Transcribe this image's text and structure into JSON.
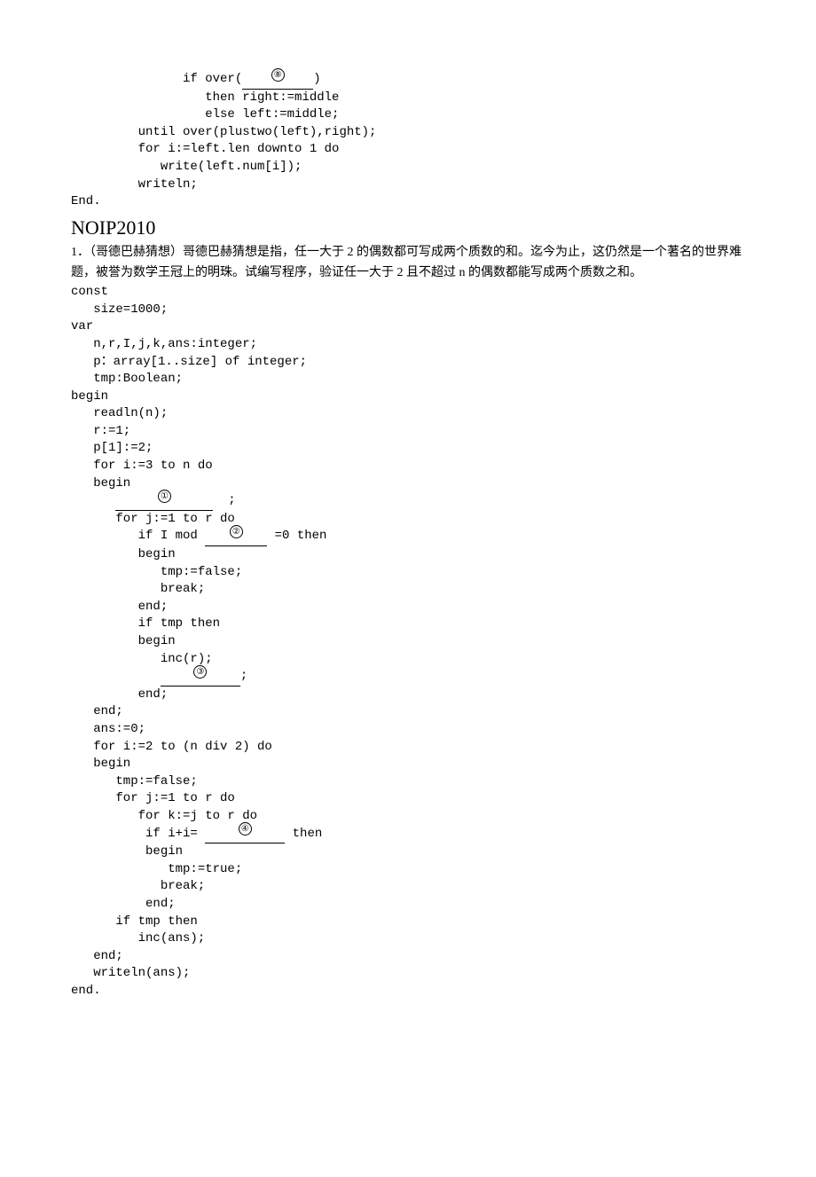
{
  "top_code": {
    "l1_pre": "               if over(",
    "l1_blank": "⑧",
    "l1_post": ")",
    "l2": "                  then right:=middle",
    "l3": "                  else left:=middle;",
    "l4": "         until over(plustwo(left),right);",
    "l5": "         for i:=left.len downto 1 do",
    "l6": "            write(left.num[i]);",
    "l7": "         writeln;",
    "l8": "End."
  },
  "heading": "NOIP2010",
  "problem_text": "1．（哥德巴赫猜想）哥德巴赫猜想是指，任一大于 2 的偶数都可写成两个质数的和。迄今为止，这仍然是一个著名的世界难题，被誉为数学王冠上的明珠。试编写程序，验证任一大于 2 且不超过 n 的偶数都能写成两个质数之和。",
  "code": {
    "c01": "const",
    "c02": "   size=1000;",
    "c03": "var",
    "c04": "   n,r,I,j,k,ans:integer;",
    "c05": "   p：array[1..size] of integer;",
    "c06": "   tmp:Boolean;",
    "c07": "begin",
    "c08": "   readln(n);",
    "c09": "   r:=1;",
    "c10": "   p[1]:=2;",
    "c11": "   for i:=3 to n do",
    "c12": "   begin",
    "c13_post": "  ;",
    "c14": "      for j:=1 to r do",
    "c15_pre": "         if I mod ",
    "c15_post": " =0 then",
    "c16": "         begin",
    "c17": "            tmp:=false;",
    "c18": "            break;",
    "c19": "         end;",
    "c20": "         if tmp then",
    "c21": "         begin",
    "c22": "            inc(r);",
    "c23_post": ";",
    "c24": "         end;",
    "c25": "   end;",
    "c26": "",
    "c27": "   ans:=0;",
    "c28": "   for i:=2 to (n div 2) do",
    "c29": "   begin",
    "c30": "      tmp:=false;",
    "c31": "      for j:=1 to r do",
    "c32": "         for k:=j to r do",
    "c33_pre": "          if i+i= ",
    "c33_post": " then",
    "c34": "          begin",
    "c35": "             tmp:=true;",
    "c36": "            break;",
    "c37": "          end;",
    "c38": "      if tmp then",
    "c39": "         inc(ans);",
    "c40": "   end;",
    "c41": "   writeln(ans);",
    "c42": "end."
  },
  "blanks": {
    "b1": "①",
    "b2": "②",
    "b3": "③",
    "b4": "④",
    "b8": "⑧"
  }
}
